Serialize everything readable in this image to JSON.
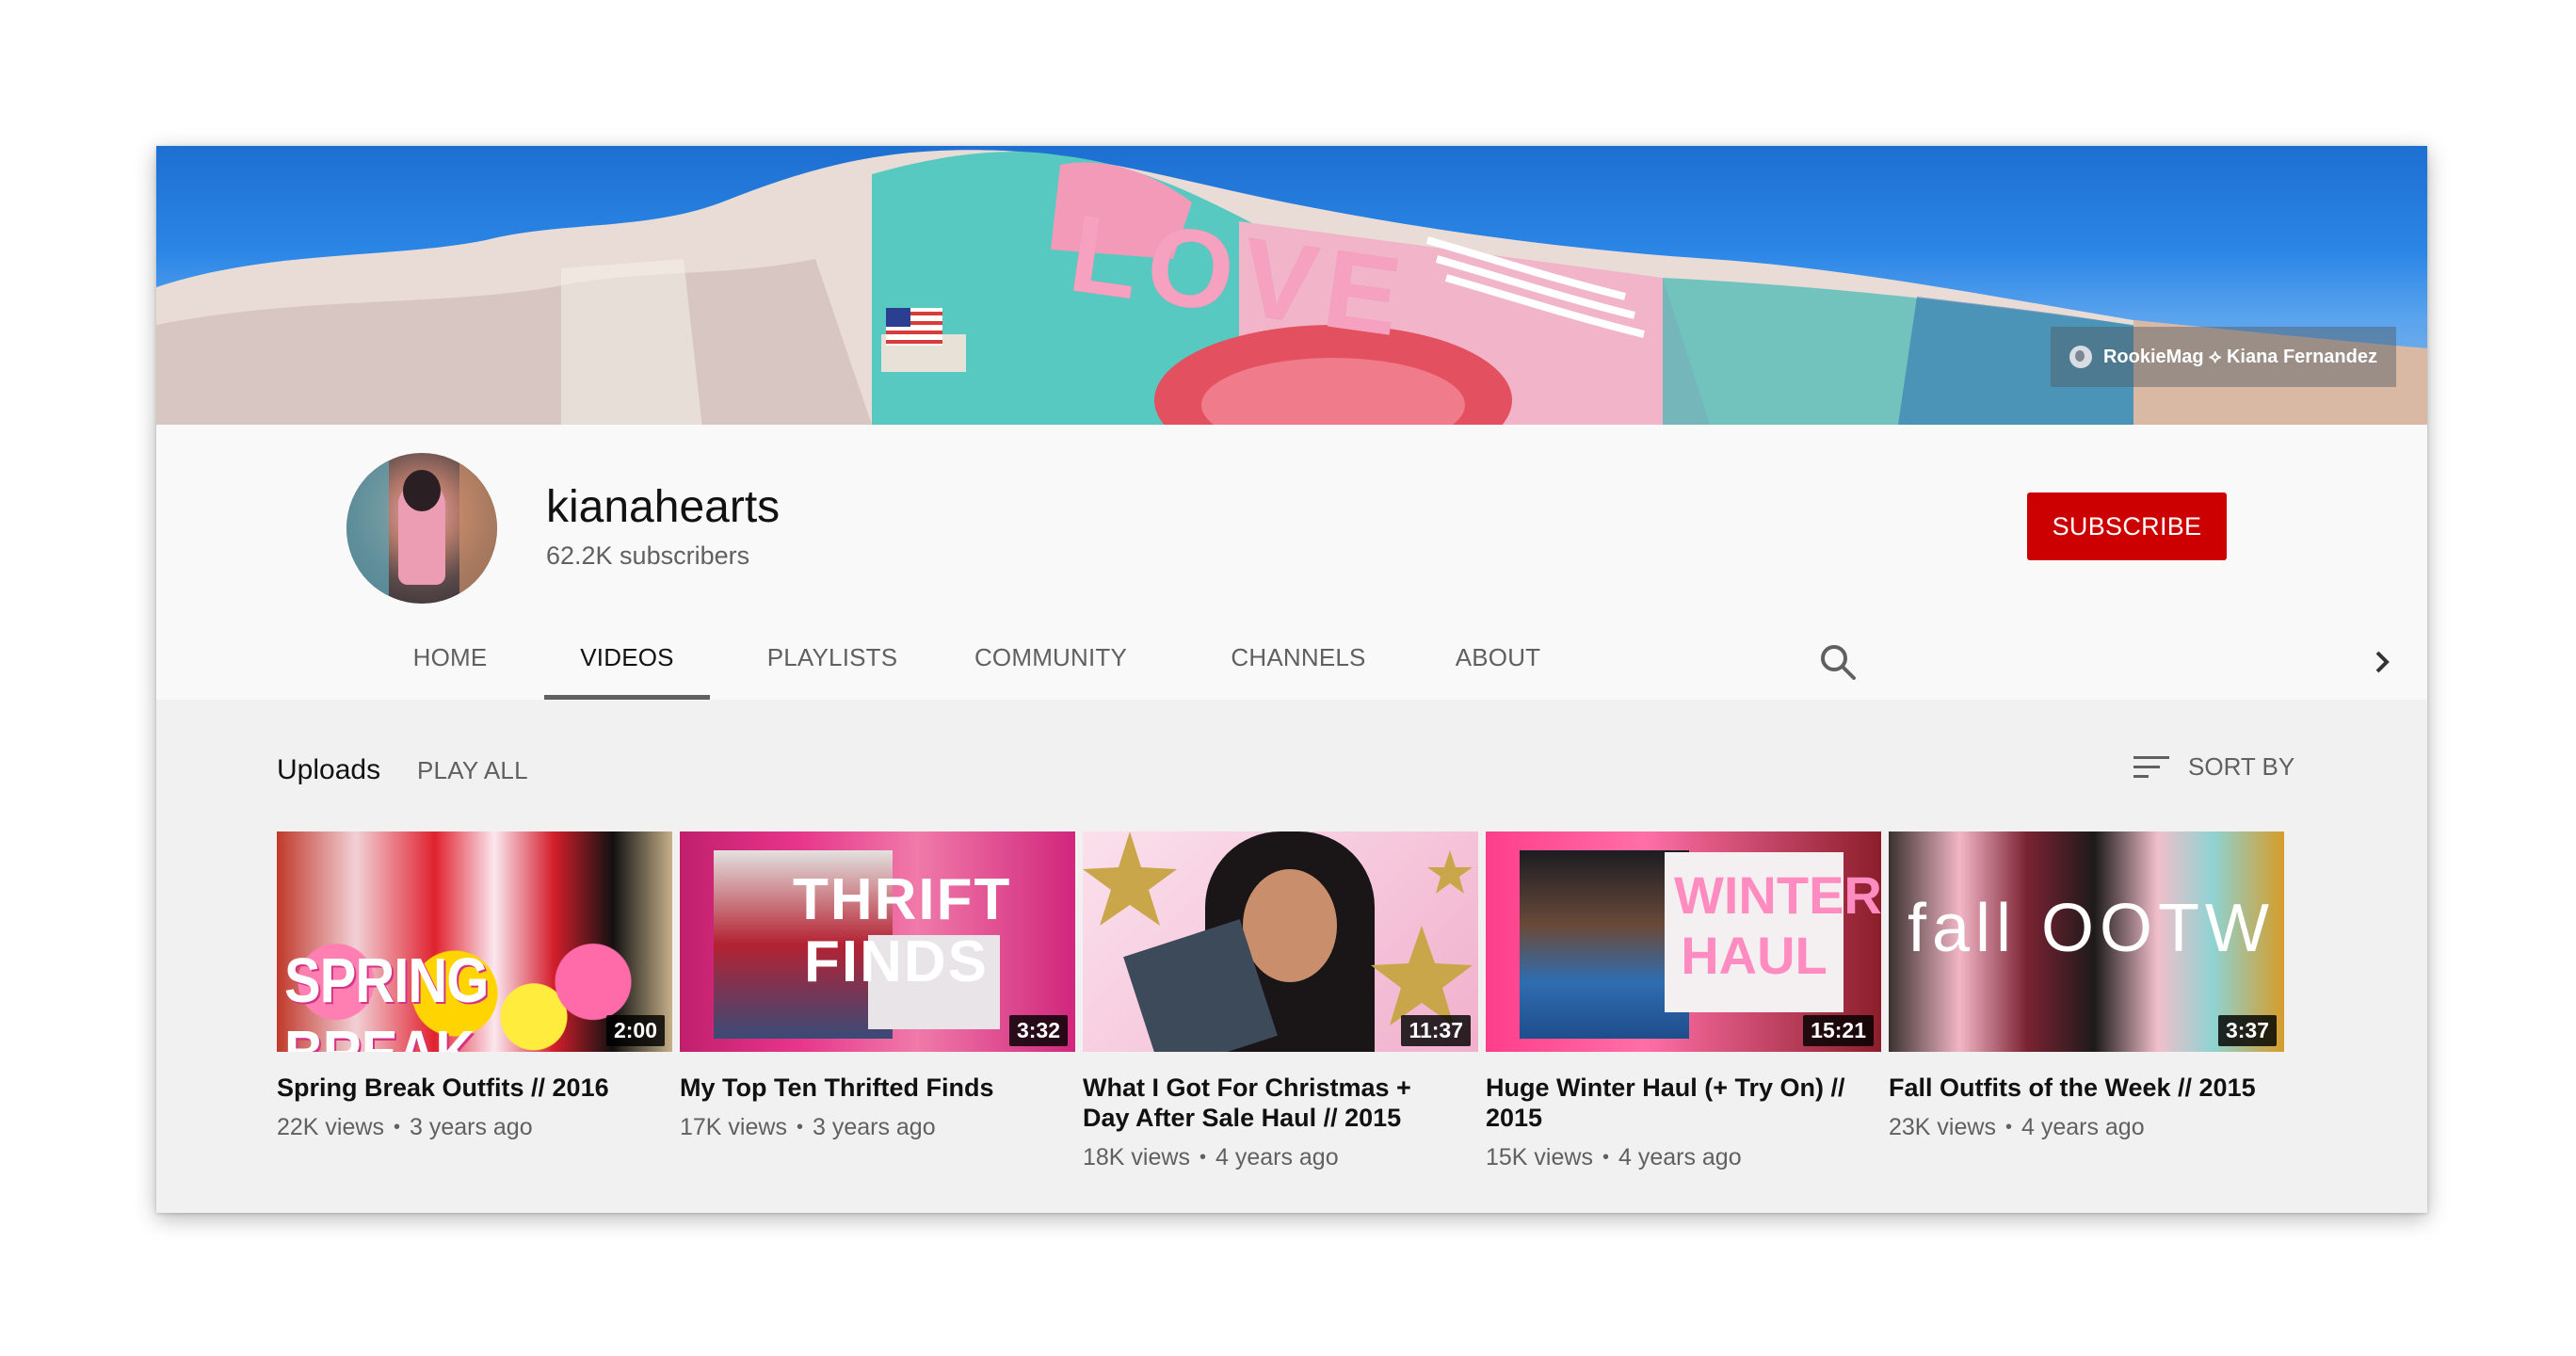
{
  "banner": {
    "link_label": "RookieMag ⟡ Kiana Fernandez",
    "art_text": "LOVE"
  },
  "channel": {
    "name": "kianahearts",
    "subscribers": "62.2K subscribers",
    "subscribe_label": "SUBSCRIBE",
    "accent_color": "#cc0000"
  },
  "tabs": [
    {
      "label": "HOME"
    },
    {
      "label": "VIDEOS",
      "active": true
    },
    {
      "label": "PLAYLISTS"
    },
    {
      "label": "COMMUNITY"
    },
    {
      "label": "CHANNELS"
    },
    {
      "label": "ABOUT"
    }
  ],
  "icons": {
    "search": "search-icon",
    "next": "chevron-right-icon",
    "sort": "sort-icon"
  },
  "shelf": {
    "title": "Uploads",
    "play_all": "PLAY ALL",
    "sort_by": "SORT BY"
  },
  "videos": [
    {
      "title": "Spring Break Outfits // 2016",
      "views": "22K views",
      "age": "3 years ago",
      "duration": "2:00",
      "thumb_text": "SPRING BREAK"
    },
    {
      "title": "My Top Ten Thrifted Finds",
      "views": "17K views",
      "age": "3 years ago",
      "duration": "3:32",
      "thumb_text": "THRIFT FINDS"
    },
    {
      "title": "What I Got For Christmas + Day After Sale Haul // 2015",
      "views": "18K views",
      "age": "4 years ago",
      "duration": "11:37",
      "thumb_text": ""
    },
    {
      "title": "Huge Winter Haul (+ Try On) // 2015",
      "views": "15K views",
      "age": "4 years ago",
      "duration": "15:21",
      "thumb_text": "WINTER HAUL"
    },
    {
      "title": "Fall Outfits of the Week // 2015",
      "views": "23K views",
      "age": "4 years ago",
      "duration": "3:37",
      "thumb_text": "fall OOTW"
    }
  ]
}
